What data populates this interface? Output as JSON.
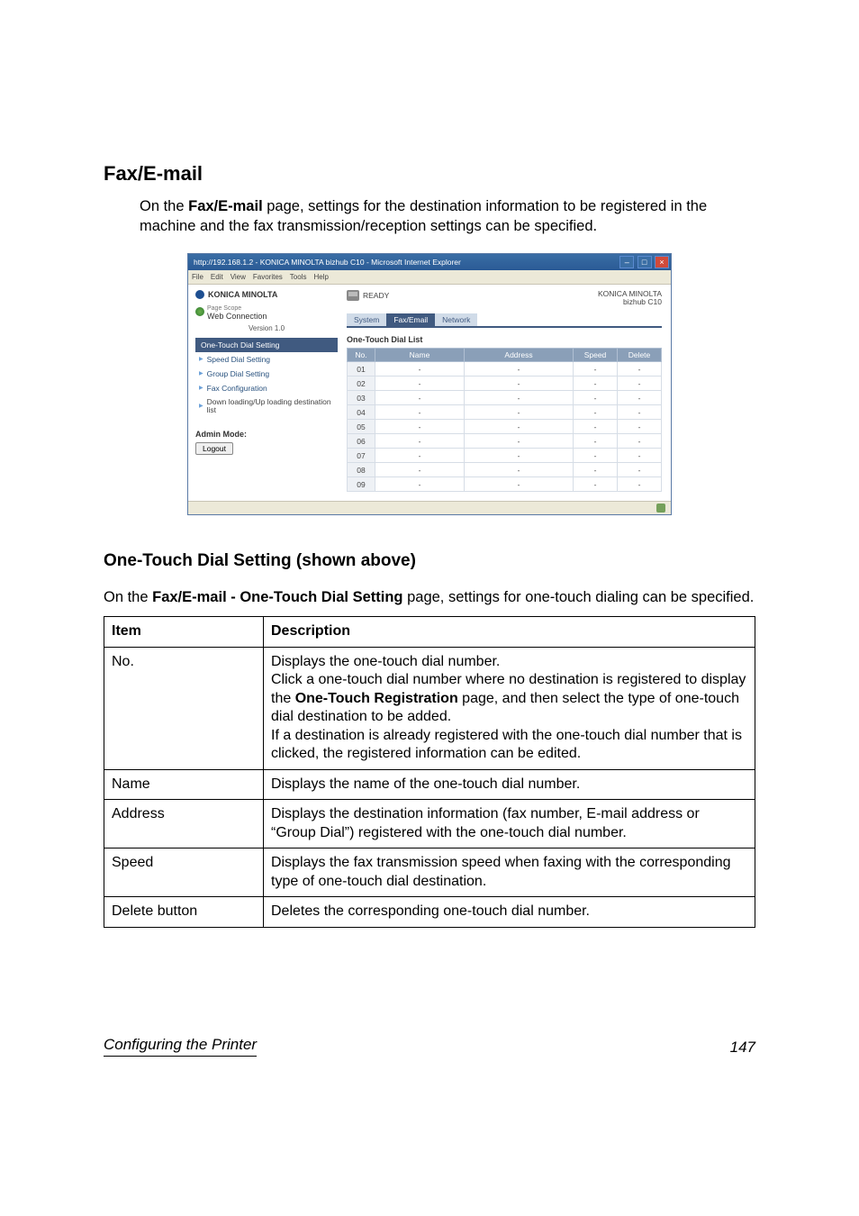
{
  "section": {
    "title": "Fax/E-mail",
    "intro_before_bold": "On the ",
    "intro_bold": "Fax/E-mail",
    "intro_after_bold": " page, settings for the destination information to be registered in the machine and the fax transmission/reception settings can be specified."
  },
  "screenshot": {
    "titlebar": "http://192.168.1.2 - KONICA MINOLTA bizhub C10 - Microsoft Internet Explorer",
    "menubar": [
      "File",
      "Edit",
      "View",
      "Favorites",
      "Tools",
      "Help"
    ],
    "brand": "KONICA MINOLTA",
    "webconn_ps": "Page Scope",
    "webconn": "Web Connection",
    "version": "Version 1.0",
    "nav_header": "One-Touch Dial Setting",
    "nav_items": [
      "Speed Dial Setting",
      "Group Dial Setting",
      "Fax Configuration",
      "Down loading/Up loading destination list"
    ],
    "admin_label": "Admin Mode:",
    "logout": "Logout",
    "status": "READY",
    "model_line1": "KONICA MINOLTA",
    "model_line2": "bizhub C10",
    "tabs": {
      "system": "System",
      "fax": "Fax/Email",
      "network": "Network"
    },
    "list_title": "One-Touch Dial List",
    "columns": {
      "no": "No.",
      "name": "Name",
      "address": "Address",
      "speed": "Speed",
      "delete": "Delete"
    },
    "rows": [
      {
        "no": "01",
        "name": "-",
        "address": "-",
        "speed": "-",
        "delete": "-"
      },
      {
        "no": "02",
        "name": "-",
        "address": "-",
        "speed": "-",
        "delete": "-"
      },
      {
        "no": "03",
        "name": "-",
        "address": "-",
        "speed": "-",
        "delete": "-"
      },
      {
        "no": "04",
        "name": "-",
        "address": "-",
        "speed": "-",
        "delete": "-"
      },
      {
        "no": "05",
        "name": "-",
        "address": "-",
        "speed": "-",
        "delete": "-"
      },
      {
        "no": "06",
        "name": "-",
        "address": "-",
        "speed": "-",
        "delete": "-"
      },
      {
        "no": "07",
        "name": "-",
        "address": "-",
        "speed": "-",
        "delete": "-"
      },
      {
        "no": "08",
        "name": "-",
        "address": "-",
        "speed": "-",
        "delete": "-"
      },
      {
        "no": "09",
        "name": "-",
        "address": "-",
        "speed": "-",
        "delete": "-"
      }
    ]
  },
  "subsection": {
    "title": "One-Touch Dial Setting (shown above)",
    "intro_before_bold": "On the ",
    "intro_bold": "Fax/E-mail - One-Touch Dial Setting",
    "intro_after_bold": " page, settings for one-touch dialing can be specified."
  },
  "table": {
    "head_item": "Item",
    "head_desc": "Description",
    "rows": [
      {
        "item": "No.",
        "desc_pre": "Displays the one-touch dial number.\nClick a one-touch dial number where no destination is registered to display the ",
        "desc_bold": "One-Touch Registration",
        "desc_post": " page, and then select the type of one-touch dial destination to be added.\nIf a destination is already registered with the one-touch dial number that is clicked, the registered information can be edited."
      },
      {
        "item": "Name",
        "desc_pre": "Displays the name of the one-touch dial number.",
        "desc_bold": "",
        "desc_post": ""
      },
      {
        "item": "Address",
        "desc_pre": "Displays the destination information (fax number, E-mail address or “Group Dial”) registered with the one-touch dial number.",
        "desc_bold": "",
        "desc_post": ""
      },
      {
        "item": "Speed",
        "desc_pre": "Displays the fax transmission speed when faxing with the corresponding type of one-touch dial destination.",
        "desc_bold": "",
        "desc_post": ""
      },
      {
        "item": "Delete button",
        "desc_pre": "Deletes the corresponding one-touch dial number.",
        "desc_bold": "",
        "desc_post": ""
      }
    ]
  },
  "footer": {
    "left": "Configuring the Printer",
    "right": "147"
  }
}
